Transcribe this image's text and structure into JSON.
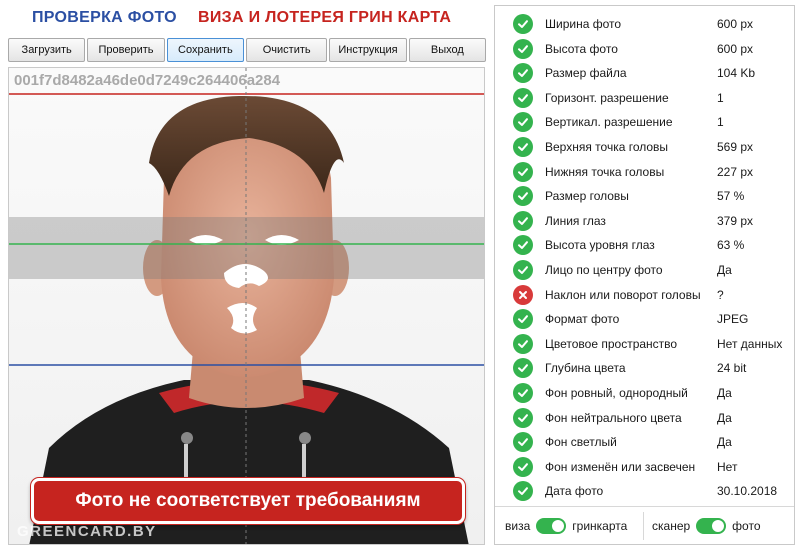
{
  "header": {
    "title_left": "ПРОВЕРКА ФОТО",
    "title_right": "ВИЗА И ЛОТЕРЕЯ ГРИН КАРТА"
  },
  "toolbar": {
    "load": "Загрузить",
    "check": "Проверить",
    "save": "Сохранить",
    "clear": "Очистить",
    "instructions": "Инструкция",
    "exit": "Выход",
    "active": "save"
  },
  "photo": {
    "hash": "001f7d8482a46de0d7249c264406a284",
    "banner": "Фото не соответствует требованиям",
    "watermark": "GREENCARD.BY"
  },
  "checks": [
    {
      "label": "Ширина фото",
      "value": "600 px",
      "status": "ok"
    },
    {
      "label": "Высота фото",
      "value": "600 px",
      "status": "ok"
    },
    {
      "label": "Размер файла",
      "value": "104 Kb",
      "status": "ok"
    },
    {
      "label": "Горизонт. разрешение",
      "value": "1",
      "status": "ok"
    },
    {
      "label": "Вертикал. разрешение",
      "value": "1",
      "status": "ok"
    },
    {
      "label": "Верхняя точка головы",
      "value": "569 px",
      "status": "ok"
    },
    {
      "label": "Нижняя точка головы",
      "value": "227 px",
      "status": "ok"
    },
    {
      "label": "Размер головы",
      "value": "57 %",
      "status": "ok"
    },
    {
      "label": "Линия глаз",
      "value": "379 px",
      "status": "ok"
    },
    {
      "label": "Высота уровня глаз",
      "value": "63 %",
      "status": "ok"
    },
    {
      "label": "Лицо по центру фото",
      "value": "Да",
      "status": "ok"
    },
    {
      "label": "Наклон или поворот головы",
      "value": "?",
      "status": "bad"
    },
    {
      "label": "Формат фото",
      "value": "JPEG",
      "status": "ok"
    },
    {
      "label": "Цветовое пространство",
      "value": "Нет данных",
      "status": "ok"
    },
    {
      "label": "Глубина цвета",
      "value": "24 bit",
      "status": "ok"
    },
    {
      "label": "Фон ровный, однородный",
      "value": "Да",
      "status": "ok"
    },
    {
      "label": "Фон нейтрального цвета",
      "value": "Да",
      "status": "ok"
    },
    {
      "label": "Фон светлый",
      "value": "Да",
      "status": "ok"
    },
    {
      "label": "Фон изменён или засвечен",
      "value": "Нет",
      "status": "ok"
    },
    {
      "label": "Дата фото",
      "value": "30.10.2018",
      "status": "ok"
    }
  ],
  "toggles": {
    "left_label": "виза",
    "right_label": "гринкарта",
    "left_on": true,
    "mode_left_label": "сканер",
    "mode_right_label": "фото",
    "mode_on": true
  },
  "colors": {
    "ok": "#34b34e",
    "bad": "#d83a3a",
    "brand_blue": "#2b4fa3",
    "brand_red": "#c6241f"
  }
}
